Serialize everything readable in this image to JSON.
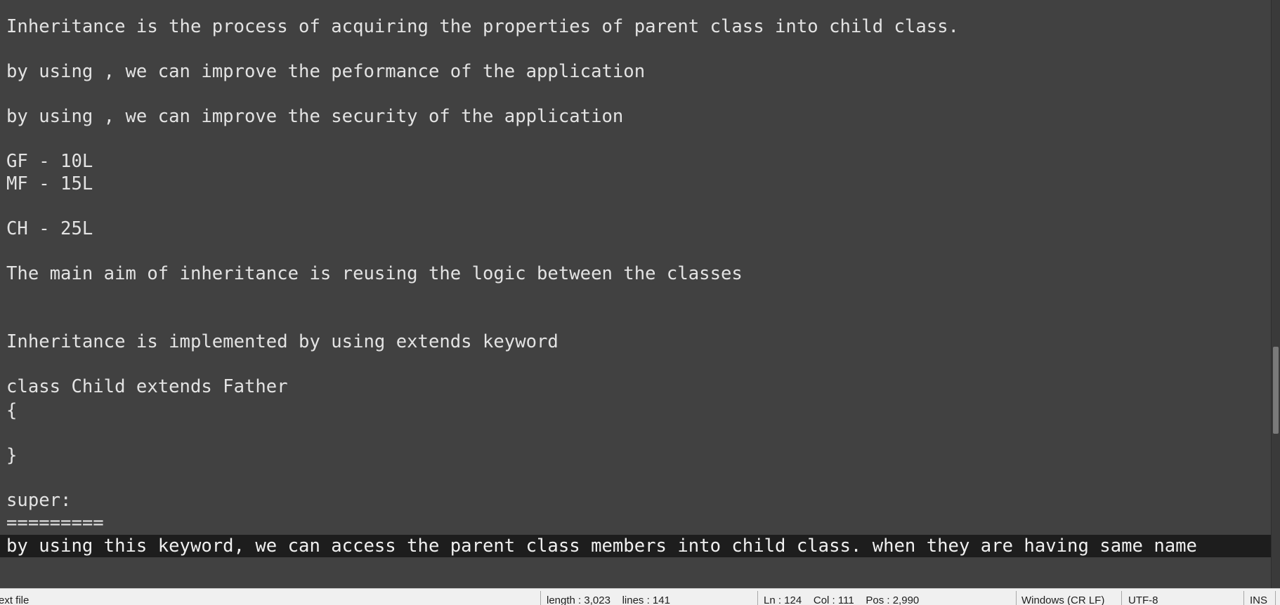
{
  "editor": {
    "lines": [
      "Inheritance is the process of acquiring the properties of parent class into child class.",
      "by using , we can improve the peformance of the application",
      "by using , we can improve the security of the application",
      "GF - 10L",
      "MF - 15L",
      "CH - 25L",
      "The main aim of inheritance is reusing the logic between the classes",
      "Inheritance is implemented by using extends keyword",
      "class Child extends Father",
      "{",
      "}",
      "super:",
      "=========",
      "by using this keyword, we can access the parent class members into child class. when they are having same name"
    ]
  },
  "statusbar": {
    "file_type": "ext file",
    "length_lines": "length : 3,023    lines : 141",
    "position": "Ln : 124    Col : 111    Pos : 2,990",
    "eol": "Windows (CR LF)",
    "encoding": "UTF-8",
    "mode": "INS"
  },
  "colors": {
    "editor_background": "#414141",
    "current_line_background": "#1d1d1d",
    "text": "#e3e3e3",
    "statusbar_background": "#f0f0f0"
  }
}
